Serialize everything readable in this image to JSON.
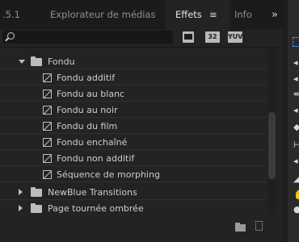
{
  "tabs": [
    {
      "label": ".5.1",
      "active": false
    },
    {
      "label": "Explorateur de médias",
      "active": false
    },
    {
      "label": "Effets",
      "active": true
    },
    {
      "label": "Info",
      "active": false
    }
  ],
  "tab_menu_icon": "≡",
  "tab_overflow_icon": "»",
  "search": {
    "value": "",
    "placeholder": ""
  },
  "filter_buttons": [
    "32",
    "YUV"
  ],
  "tree": [
    {
      "type": "folder",
      "label": "Fondu",
      "expanded": true
    },
    {
      "type": "effect",
      "label": "Fondu additif"
    },
    {
      "type": "effect",
      "label": "Fondu au blanc"
    },
    {
      "type": "effect",
      "label": "Fondu au noir"
    },
    {
      "type": "effect",
      "label": "Fondu du film"
    },
    {
      "type": "effect",
      "label": "Fondu enchaîné"
    },
    {
      "type": "effect",
      "label": "Fondu non additif"
    },
    {
      "type": "effect",
      "label": "Séquence de morphing"
    },
    {
      "type": "folder",
      "label": "NewBlue Transitions",
      "expanded": false
    },
    {
      "type": "folder",
      "label": "Page tournée ombrée",
      "expanded": false
    }
  ],
  "colors": {
    "panel": "#232323",
    "tabbar": "#1b1b1b",
    "text": "#cdcdcd",
    "accent": "#4b8df0"
  }
}
